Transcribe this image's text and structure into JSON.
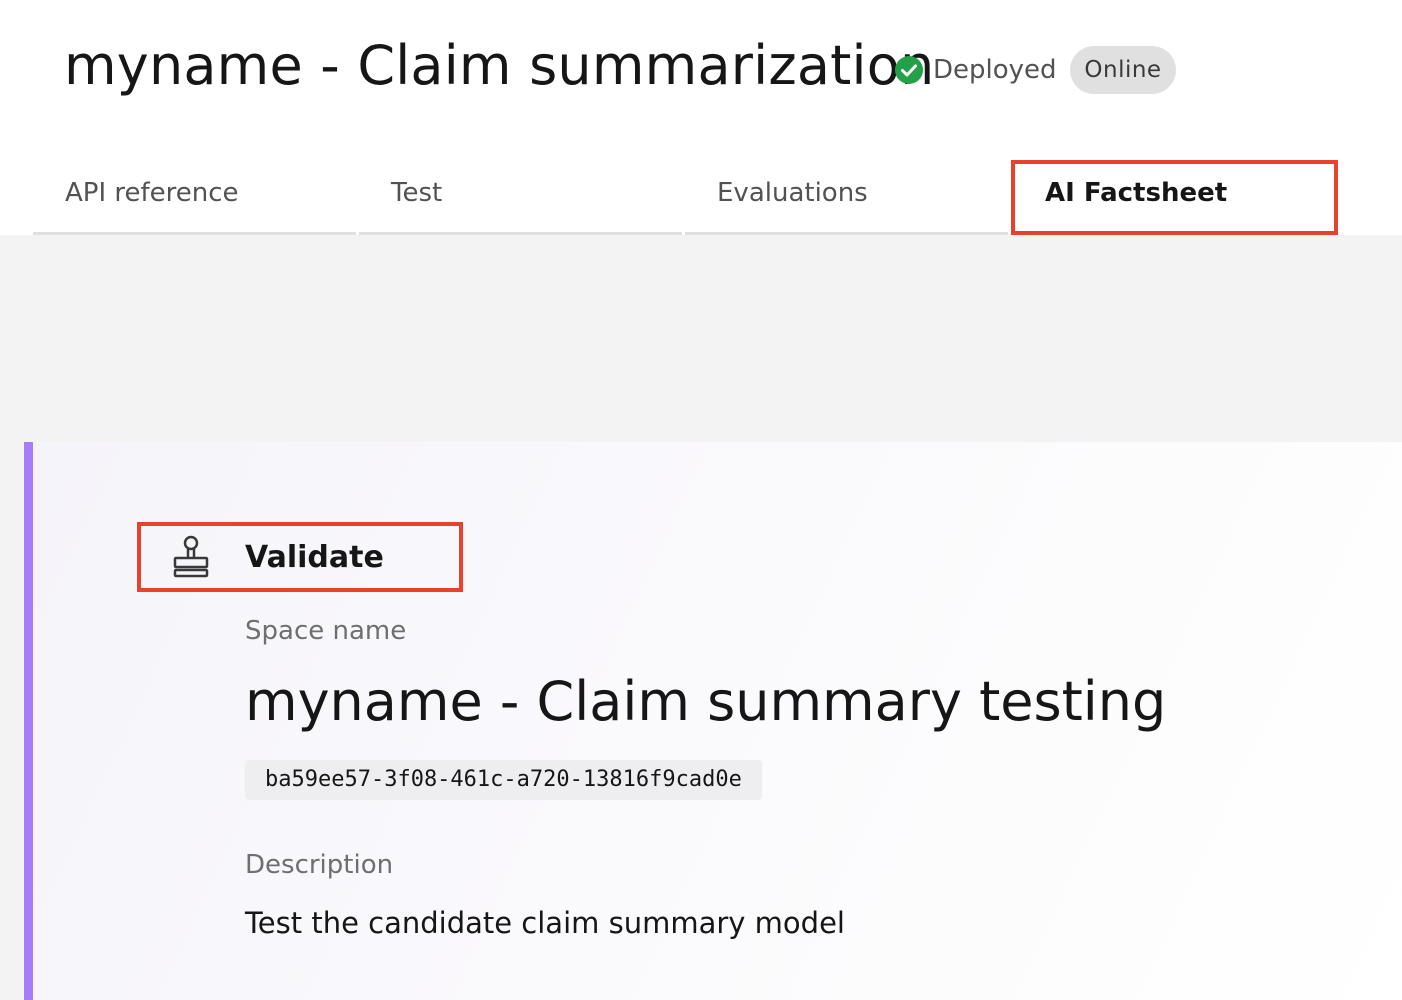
{
  "header": {
    "title": "myname - Claim summarization",
    "status": {
      "icon": "checkmark-filled-icon",
      "label": "Deployed",
      "color": "#24a148"
    },
    "tag": "Online"
  },
  "tabs": [
    {
      "label": "API reference",
      "selected": false
    },
    {
      "label": "Test",
      "selected": false
    },
    {
      "label": "Evaluations",
      "selected": false
    },
    {
      "label": "AI Factsheet",
      "selected": true
    }
  ],
  "factsheet": {
    "accent_color": "#a77cf7",
    "highlight_color": "#e8412c",
    "stage": {
      "icon": "stamp-icon",
      "label": "Validate"
    },
    "space_name_label": "Space name",
    "space_name": "myname - Claim summary testing",
    "space_id": "ba59ee57-3f08-461c-a720-13816f9cad0e",
    "description_label": "Description",
    "description": "Test the candidate claim summary model"
  }
}
